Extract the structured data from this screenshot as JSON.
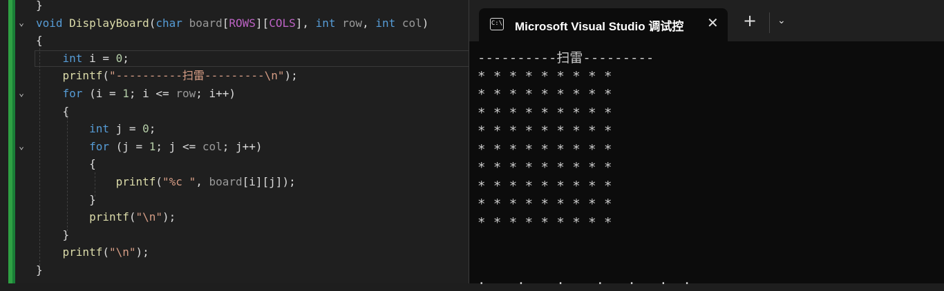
{
  "editor": {
    "lines": [
      {
        "indent": "",
        "tokens": [
          {
            "t": "}",
            "c": ""
          }
        ]
      },
      {
        "indent": "",
        "tokens": [
          {
            "t": "void ",
            "c": "kw"
          },
          {
            "t": "DisplayBoard",
            "c": "fn"
          },
          {
            "t": "(",
            "c": ""
          },
          {
            "t": "char ",
            "c": "kw"
          },
          {
            "t": "board",
            "c": "param"
          },
          {
            "t": "[",
            "c": ""
          },
          {
            "t": "ROWS",
            "c": "macro"
          },
          {
            "t": "][",
            "c": ""
          },
          {
            "t": "COLS",
            "c": "macro"
          },
          {
            "t": "], ",
            "c": ""
          },
          {
            "t": "int ",
            "c": "kw"
          },
          {
            "t": "row",
            "c": "param"
          },
          {
            "t": ", ",
            "c": ""
          },
          {
            "t": "int ",
            "c": "kw"
          },
          {
            "t": "col",
            "c": "param"
          },
          {
            "t": ")",
            "c": ""
          }
        ]
      },
      {
        "indent": "",
        "tokens": [
          {
            "t": "{",
            "c": ""
          }
        ]
      },
      {
        "indent": "    ",
        "tokens": [
          {
            "t": "int ",
            "c": "kw"
          },
          {
            "t": "i = ",
            "c": ""
          },
          {
            "t": "0",
            "c": "num"
          },
          {
            "t": ";",
            "c": ""
          }
        ]
      },
      {
        "indent": "    ",
        "tokens": [
          {
            "t": "printf",
            "c": "fn"
          },
          {
            "t": "(",
            "c": ""
          },
          {
            "t": "\"----------扫雷---------\\n\"",
            "c": "str"
          },
          {
            "t": ");",
            "c": ""
          }
        ]
      },
      {
        "indent": "    ",
        "tokens": [
          {
            "t": "for ",
            "c": "kw"
          },
          {
            "t": "(i = ",
            "c": ""
          },
          {
            "t": "1",
            "c": "num"
          },
          {
            "t": "; i <= ",
            "c": ""
          },
          {
            "t": "row",
            "c": "param"
          },
          {
            "t": "; i++)",
            "c": ""
          }
        ]
      },
      {
        "indent": "    ",
        "tokens": [
          {
            "t": "{",
            "c": ""
          }
        ]
      },
      {
        "indent": "        ",
        "tokens": [
          {
            "t": "int ",
            "c": "kw"
          },
          {
            "t": "j = ",
            "c": ""
          },
          {
            "t": "0",
            "c": "num"
          },
          {
            "t": ";",
            "c": ""
          }
        ]
      },
      {
        "indent": "        ",
        "tokens": [
          {
            "t": "for ",
            "c": "kw"
          },
          {
            "t": "(j = ",
            "c": ""
          },
          {
            "t": "1",
            "c": "num"
          },
          {
            "t": "; j <= ",
            "c": ""
          },
          {
            "t": "col",
            "c": "param"
          },
          {
            "t": "; j++)",
            "c": ""
          }
        ]
      },
      {
        "indent": "        ",
        "tokens": [
          {
            "t": "{",
            "c": ""
          }
        ]
      },
      {
        "indent": "            ",
        "tokens": [
          {
            "t": "printf",
            "c": "fn"
          },
          {
            "t": "(",
            "c": ""
          },
          {
            "t": "\"%c \"",
            "c": "str"
          },
          {
            "t": ", ",
            "c": ""
          },
          {
            "t": "board",
            "c": "param"
          },
          {
            "t": "[i][j]);",
            "c": ""
          }
        ]
      },
      {
        "indent": "        ",
        "tokens": [
          {
            "t": "}",
            "c": ""
          }
        ]
      },
      {
        "indent": "        ",
        "tokens": [
          {
            "t": "printf",
            "c": "fn"
          },
          {
            "t": "(",
            "c": ""
          },
          {
            "t": "\"\\n\"",
            "c": "str"
          },
          {
            "t": ");",
            "c": ""
          }
        ]
      },
      {
        "indent": "    ",
        "tokens": [
          {
            "t": "}",
            "c": ""
          }
        ]
      },
      {
        "indent": "    ",
        "tokens": [
          {
            "t": "printf",
            "c": "fn"
          },
          {
            "t": "(",
            "c": ""
          },
          {
            "t": "\"\\n\"",
            "c": "str"
          },
          {
            "t": ");",
            "c": ""
          }
        ]
      },
      {
        "indent": "",
        "tokens": [
          {
            "t": "}",
            "c": ""
          }
        ]
      }
    ]
  },
  "terminal": {
    "tab_title": "Microsoft Visual Studio 调试控",
    "tab_icon": "console-icon",
    "close_icon": "close-icon",
    "new_tab_icon": "plus-icon",
    "dropdown_icon": "chevron-down-icon",
    "output_lines": [
      "----------扫雷---------",
      "* * * * * * * * *",
      "* * * * * * * * *",
      "* * * * * * * * *",
      "* * * * * * * * *",
      "* * * * * * * * *",
      "* * * * * * * * *",
      "* * * * * * * * *",
      "* * * * * * * * *",
      "* * * * * * * * *"
    ]
  },
  "colors": {
    "keyword": "#569cd6",
    "function": "#dcdcaa",
    "string": "#d69d85",
    "number": "#b5cea8",
    "macro": "#bd63c5",
    "change_bar": "#2ea043",
    "terminal_bg": "#0c0c0c"
  }
}
